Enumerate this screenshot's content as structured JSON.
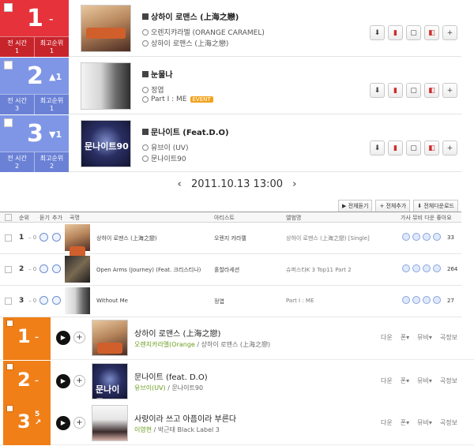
{
  "top_chart": {
    "stat_labels": [
      "전 시간",
      "최고순위"
    ],
    "rows": [
      {
        "rank": "1",
        "change": "–",
        "prev": "1",
        "best": "1",
        "title": "상하이 로맨스 (上海之戀)",
        "artist": "오렌지캬라멜 (ORANGE CARAMEL)",
        "album": "상하이 로맨스 (上海之戀)",
        "event": ""
      },
      {
        "rank": "2",
        "change": "▲1",
        "prev": "3",
        "best": "1",
        "title": "눈물나",
        "artist": "정엽",
        "album": "Part I : ME",
        "event": "EVENT"
      },
      {
        "rank": "3",
        "change": "▼1",
        "prev": "2",
        "best": "2",
        "title": "문나이트 (Feat.D.O)",
        "artist": "유브이 (UV)",
        "album": "문나이트90",
        "event": ""
      }
    ]
  },
  "date_bar": {
    "date": "2011.10.13 13:00",
    "prev": "‹",
    "next": "›"
  },
  "list_buttons": [
    "▶ 전체듣기",
    "+ 전체추가",
    "⬇ 전체다운로드"
  ],
  "list_header": {
    "rank": "순위",
    "listen": "듣기",
    "add": "추가",
    "song": "곡명",
    "artist": "아티스트",
    "album": "앨범명",
    "tools": "가사 뮤비 다운 좋아요"
  },
  "list_rows": [
    {
      "rank": "1",
      "change": "– 0",
      "title": "상하이 로맨스 (上海之戀)",
      "artist": "오렌지 캬라멜",
      "album": "상하이 로맨스 (上海之戀) [Single]",
      "likes": "33"
    },
    {
      "rank": "2",
      "change": "– 0",
      "title": "Open Arms (Journey) (Feat. 크리스티나)",
      "artist": "홀할라세션",
      "album": "슈퍼스타K 3 Top11 Part 2",
      "likes": "264"
    },
    {
      "rank": "3",
      "change": "– 0",
      "title": "Without Me",
      "artist": "정엽",
      "album": "Part I : ME",
      "likes": "27"
    }
  ],
  "orange_chart": {
    "actions": [
      "다운",
      "폰▾",
      "뮤비▾",
      "곡정보"
    ],
    "rows": [
      {
        "rank": "1",
        "change": "–",
        "up": "",
        "title": "상하이 로맨스 (上海之戀)",
        "artist": "오렌지카라멜(Orange",
        "album": "상하이 로맨스 (上海之戀)"
      },
      {
        "rank": "2",
        "change": "–",
        "up": "",
        "title": "문나이트 (feat. D.O)",
        "artist": "유브이(UV)",
        "album": "문나이트90"
      },
      {
        "rank": "3",
        "change": "↗",
        "up": "5",
        "title": "사랑이라 쓰고 아픔이라 부른다",
        "artist": "이영현",
        "album": "박근태 Black Label 3"
      }
    ]
  }
}
